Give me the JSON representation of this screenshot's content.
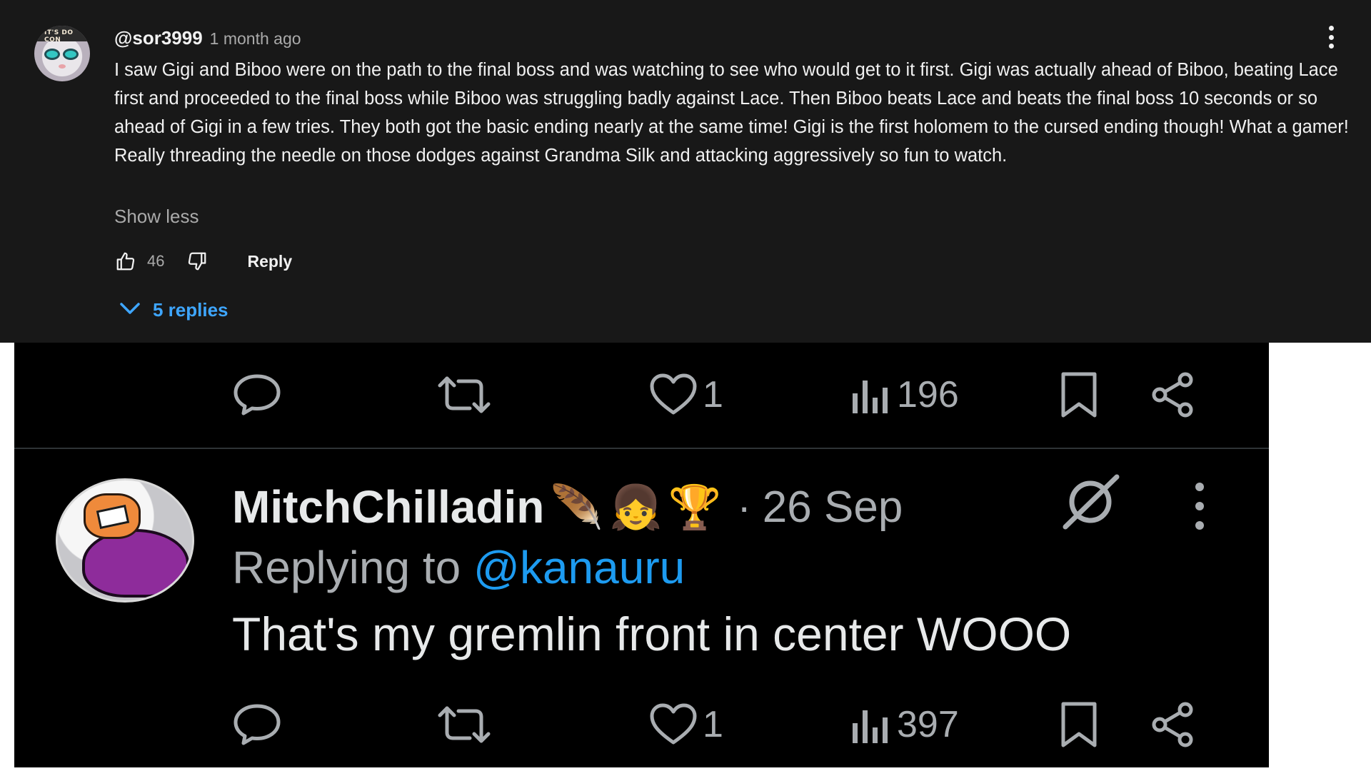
{
  "youtube_comment": {
    "avatar_text": "IT'S DO CON",
    "username": "@sor3999",
    "timestamp": "1 month ago",
    "body": "I saw Gigi and Biboo were on the path to the final boss and was watching to see who would get to it first. Gigi was actually ahead of Biboo, beating Lace first and proceeded to the final boss while Biboo was struggling badly against Lace. Then Biboo beats Lace and beats the final boss 10 seconds or so ahead of Gigi in a few tries. They both got the basic ending nearly at the same time! Gigi is the first holomem to the cursed ending though! What a gamer! Really threading the needle on those dodges against Grandma Silk and attacking aggressively so fun to watch.",
    "show_less_label": "Show less",
    "like_count": "46",
    "reply_label": "Reply",
    "replies_label": "5 replies",
    "accent_color": "#3ea6ff"
  },
  "tweet_top_actions": {
    "like_count": "1",
    "view_count": "196"
  },
  "tweet": {
    "display_name": "MitchChilladin",
    "name_emojis": [
      "🪶",
      "👧",
      "🏆"
    ],
    "separator": "·",
    "date": "26 Sep",
    "replying_prefix": "Replying to",
    "replying_handle": "@kanauru",
    "text": "That's my gremlin front in center WOOO",
    "like_count": "1",
    "view_count": "397",
    "accent_color": "#1d9bf0",
    "icons": [
      "reply-icon",
      "retweet-icon",
      "like-icon",
      "views-icon",
      "bookmark-icon",
      "share-icon",
      "grok-icon",
      "more-icon"
    ]
  }
}
